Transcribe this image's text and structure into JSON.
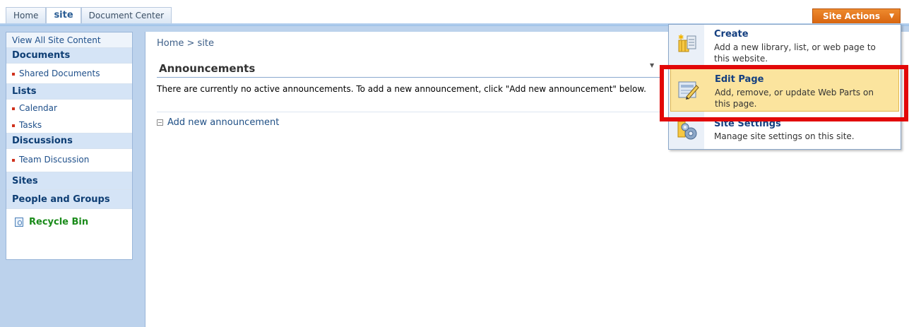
{
  "tabs": [
    {
      "label": "Home",
      "selected": false
    },
    {
      "label": "site",
      "selected": true
    },
    {
      "label": "Document Center",
      "selected": false
    }
  ],
  "site_actions": {
    "label": "Site Actions"
  },
  "leftnav": {
    "view_all": "View All Site Content",
    "documents_heading": "Documents",
    "shared_documents": "Shared Documents",
    "lists_heading": "Lists",
    "calendar": "Calendar",
    "tasks": "Tasks",
    "discussions_heading": "Discussions",
    "team_discussion": "Team Discussion",
    "sites_heading": "Sites",
    "people_heading": "People and Groups",
    "recycle_bin": "Recycle Bin"
  },
  "main": {
    "breadcrumb": "Home > site",
    "webpart_title": "Announcements",
    "webpart_text": "There are currently no active announcements. To add a new announcement, click \"Add new announcement\" below.",
    "add_link": "Add new announcement"
  },
  "menu": {
    "create": {
      "title": "Create",
      "desc": "Add a new library, list, or web page to this website.",
      "icon": "create-icon"
    },
    "edit_page": {
      "title": "Edit Page",
      "desc": "Add, remove, or update Web Parts on this page.",
      "icon": "edit-page-icon"
    },
    "site_settings": {
      "title": "Site Settings",
      "desc": "Manage site settings on this site.",
      "icon": "site-settings-icon"
    }
  },
  "colors": {
    "highlight_box": "#e20808",
    "site_actions": "#e57a22",
    "menu_highlight": "#fbe49e"
  }
}
